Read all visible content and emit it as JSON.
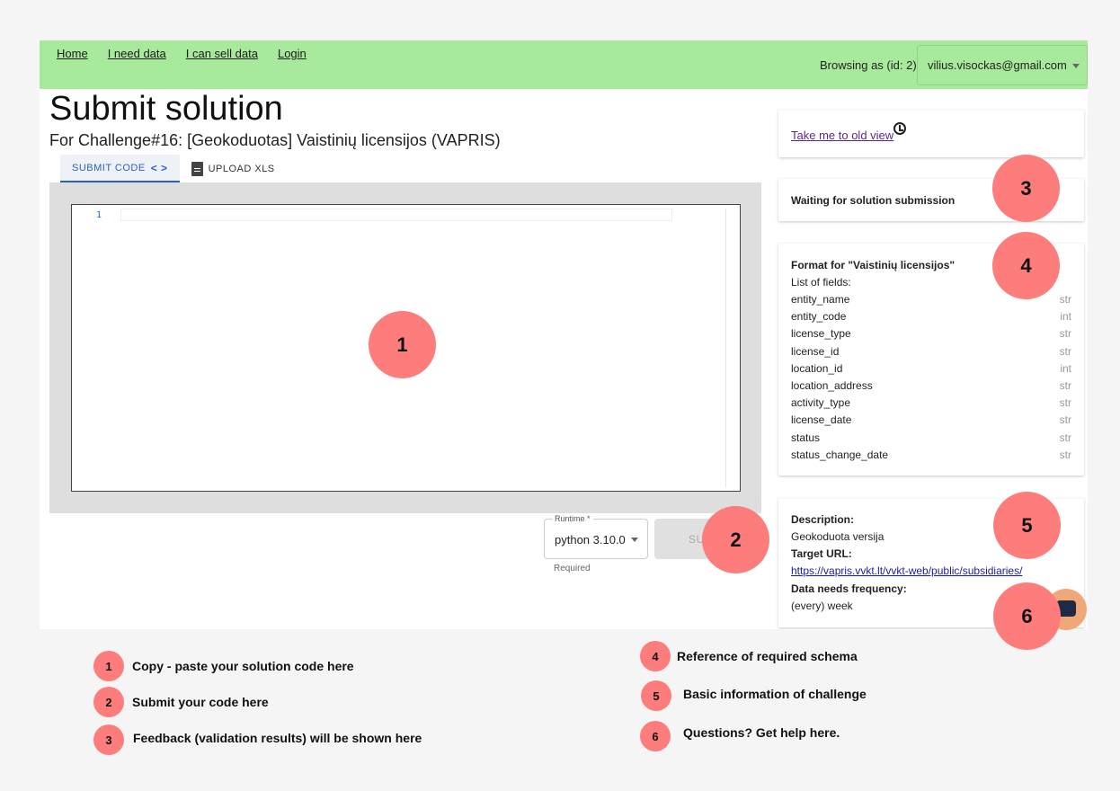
{
  "nav": [
    "Home",
    "I need data",
    "I can sell data",
    "Login"
  ],
  "header": {
    "browsing_label": "Browsing as (id: 2)",
    "user_email": "vilius.visockas@gmail.com"
  },
  "page": {
    "title": "Submit solution",
    "subtitle": "For Challenge#16: [Geokoduotas] Vaistinių licensijos (VAPRIS)"
  },
  "tabs": [
    {
      "label": "Submit code",
      "icon": "code-icon",
      "active": true
    },
    {
      "label": "Upload XLS",
      "icon": "document-icon",
      "active": false
    }
  ],
  "editor": {
    "line_number": "1"
  },
  "runtime": {
    "label": "Runtime *",
    "value": "python 3.10.0",
    "helper": "Required"
  },
  "submit": {
    "label": "SU"
  },
  "sidebar": {
    "old_view_link": "Take me to old view",
    "status": "Waiting for solution submission",
    "format": {
      "title": "Format for \"Vaistinių licensijos\"",
      "list_label": "List of fields:",
      "fields": [
        {
          "name": "entity_name",
          "type": "str"
        },
        {
          "name": "entity_code",
          "type": "int"
        },
        {
          "name": "license_type",
          "type": "str"
        },
        {
          "name": "license_id",
          "type": "str"
        },
        {
          "name": "location_id",
          "type": "int"
        },
        {
          "name": "location_address",
          "type": "str"
        },
        {
          "name": "activity_type",
          "type": "str"
        },
        {
          "name": "license_date",
          "type": "str"
        },
        {
          "name": "status",
          "type": "str"
        },
        {
          "name": "status_change_date",
          "type": "str"
        }
      ]
    },
    "description": {
      "desc_label": "Description:",
      "desc_value": "Geokoduota versija",
      "url_label": "Target URL:",
      "url_value": "https://vapris.vvkt.lt/vvkt-web/public/subsidiaries/",
      "freq_label": "Data needs frequency:",
      "freq_value": "(every) week"
    }
  },
  "markers": [
    "1",
    "2",
    "3",
    "4",
    "5",
    "6"
  ],
  "legend": [
    {
      "num": "1",
      "text": "Copy - paste your solution code here"
    },
    {
      "num": "2",
      "text": "Submit your code here"
    },
    {
      "num": "3",
      "text": "Feedback (validation results) will be shown here"
    },
    {
      "num": "4",
      "text": "Reference of required schema"
    },
    {
      "num": "5",
      "text": "Basic information of challenge"
    },
    {
      "num": "6",
      "text": "Questions? Get help here."
    }
  ],
  "colors": {
    "topbar": "#a8ea9b",
    "marker": "#fd7d7d",
    "accent": "#2962c4",
    "chat": "#f0a878"
  }
}
